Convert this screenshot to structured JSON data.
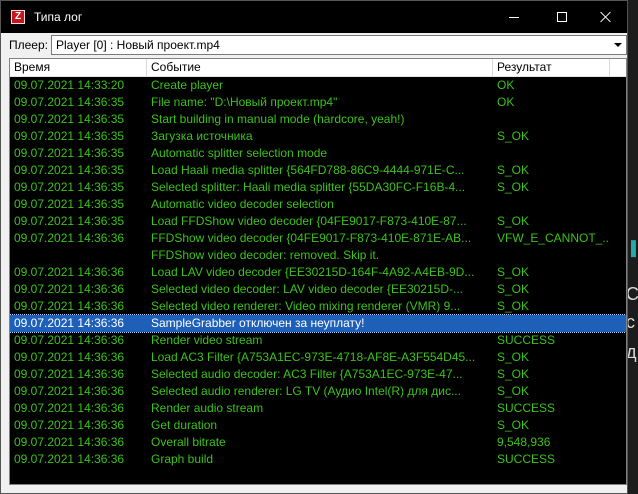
{
  "window": {
    "title": "Типа лог",
    "icon_letter": "Z"
  },
  "player": {
    "label": "Плеер:",
    "selected": "Player [0] : Новый проект.mp4"
  },
  "columns": [
    "Время",
    "Событие",
    "Результат"
  ],
  "rows": [
    {
      "time": "09.07.2021 14:33:20",
      "event": "Create player",
      "result": "OK"
    },
    {
      "time": "09.07.2021 14:36:35",
      "event": "File name: \"D:\\Новый проект.mp4\"",
      "result": "OK"
    },
    {
      "time": "09.07.2021 14:36:35",
      "event": "Start building in manual mode (hardcore, yeah!)",
      "result": ""
    },
    {
      "time": "09.07.2021 14:36:35",
      "event": "Загузка источника",
      "result": "S_OK"
    },
    {
      "time": "09.07.2021 14:36:35",
      "event": "Automatic splitter selection mode",
      "result": ""
    },
    {
      "time": "09.07.2021 14:36:35",
      "event": "Load Haali media splitter {564FD788-86C9-4444-971E-C...",
      "result": "S_OK"
    },
    {
      "time": "09.07.2021 14:36:35",
      "event": "Selected splitter: Haali media splitter {55DA30FC-F16B-4...",
      "result": "S_OK"
    },
    {
      "time": "09.07.2021 14:36:35",
      "event": "Automatic video decoder selection",
      "result": ""
    },
    {
      "time": "09.07.2021 14:36:35",
      "event": "Load FFDShow video decoder {04FE9017-F873-410E-87...",
      "result": "S_OK"
    },
    {
      "time": "09.07.2021 14:36:36",
      "event": "FFDShow video decoder {04FE9017-F873-410E-871E-AB...",
      "result": "VFW_E_CANNOT_..."
    },
    {
      "time": "",
      "event": "FFDShow video decoder: removed. Skip it.",
      "result": ""
    },
    {
      "time": "09.07.2021 14:36:36",
      "event": "Load LAV video decoder {EE30215D-164F-4A92-A4EB-9D...",
      "result": "S_OK"
    },
    {
      "time": "09.07.2021 14:36:36",
      "event": "Selected video decoder: LAV video decoder {EE30215D-...",
      "result": "S_OK"
    },
    {
      "time": "09.07.2021 14:36:36",
      "event": "Selected video renderer: Video mixing renderer (VMR) 9...",
      "result": "S_OK"
    },
    {
      "time": "09.07.2021 14:36:36",
      "event": "SampleGrabber отключен за неуплату!",
      "result": "",
      "selected": true
    },
    {
      "time": "09.07.2021 14:36:36",
      "event": "Render video stream",
      "result": "SUCCESS"
    },
    {
      "time": "09.07.2021 14:36:36",
      "event": "Load AC3 Filter {A753A1EC-973E-4718-AF8E-A3F554D45...",
      "result": "S_OK"
    },
    {
      "time": "09.07.2021 14:36:36",
      "event": "Selected audio decoder: AC3 Filter {A753A1EC-973E-47...",
      "result": "S_OK"
    },
    {
      "time": "09.07.2021 14:36:36",
      "event": "Selected audio renderer: LG TV (Аудио Intel(R) для дис...",
      "result": "S_OK"
    },
    {
      "time": "09.07.2021 14:36:36",
      "event": "Render audio stream",
      "result": "SUCCESS"
    },
    {
      "time": "09.07.2021 14:36:36",
      "event": "Get duration",
      "result": "S_OK"
    },
    {
      "time": "09.07.2021 14:36:36",
      "event": "Overall bitrate",
      "result": "9,548,936"
    },
    {
      "time": "09.07.2021 14:36:36",
      "event": "Graph build",
      "result": "SUCCESS"
    }
  ],
  "background_glyphs": [
    "C",
    "с",
    "д"
  ],
  "colors": {
    "text_green": "#3ac219",
    "selection": "#1e5fb8",
    "titlebar": "#000000"
  }
}
